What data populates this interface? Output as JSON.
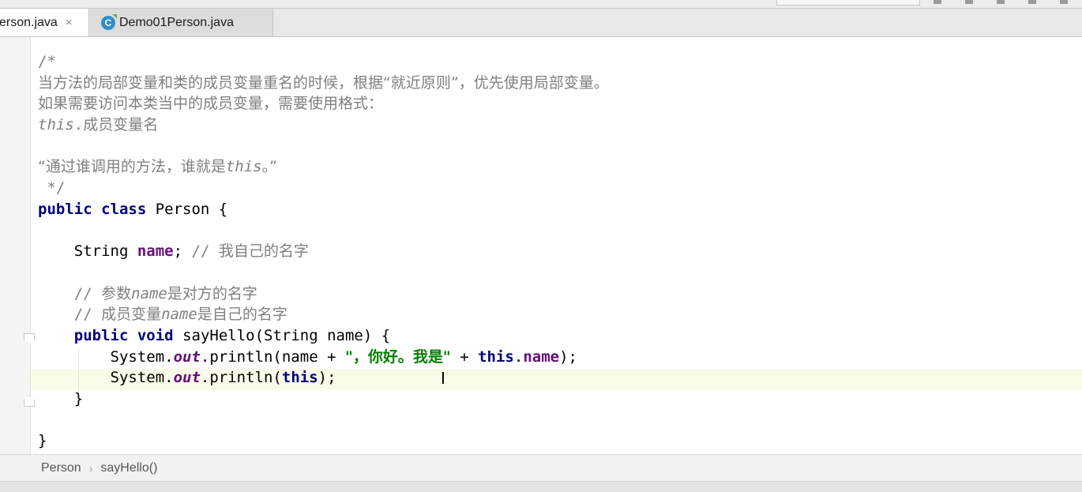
{
  "tabs": [
    {
      "label": "erson.java",
      "close": "×",
      "active": true
    },
    {
      "label": "Demo01Person.java",
      "close": "×",
      "active": false,
      "icon": "class-icon",
      "icon_letter": "C"
    }
  ],
  "code_lines": [
    [
      {
        "t": "/*",
        "c": "cm"
      }
    ],
    [
      {
        "t": "当方法的局部变量和类的成员变量重名的时候，根据“就近原则”，优先使用局部变量。",
        "c": "cm cjk"
      }
    ],
    [
      {
        "t": "如果需要访问本类当中的成员变量，需要使用格式：",
        "c": "cm cjk"
      }
    ],
    [
      {
        "t": "this",
        "c": "cmt"
      },
      {
        "t": ".",
        "c": "cm"
      },
      {
        "t": "成员变量名",
        "c": "cm cjk"
      }
    ],
    [],
    [
      {
        "t": "“通过谁调用的方法，谁就是",
        "c": "cm cjk"
      },
      {
        "t": "this",
        "c": "cmt"
      },
      {
        "t": "。”",
        "c": "cm cjk"
      }
    ],
    [
      {
        "t": " */",
        "c": "cm"
      }
    ],
    [
      {
        "t": "public",
        "c": "kw"
      },
      {
        "t": " "
      },
      {
        "t": "class",
        "c": "kw"
      },
      {
        "t": " Person {"
      }
    ],
    [],
    [
      {
        "t": "    String "
      },
      {
        "t": "name",
        "c": "fld"
      },
      {
        "t": "; "
      },
      {
        "t": "// ",
        "c": "cm"
      },
      {
        "t": "我自己的名字",
        "c": "cm cjk"
      }
    ],
    [],
    [
      {
        "t": "    // ",
        "c": "cm"
      },
      {
        "t": "参数",
        "c": "cm cjk"
      },
      {
        "t": "name",
        "c": "cmt"
      },
      {
        "t": "是对方的名字",
        "c": "cm cjk"
      }
    ],
    [
      {
        "t": "    // ",
        "c": "cm"
      },
      {
        "t": "成员变量",
        "c": "cm cjk"
      },
      {
        "t": "name",
        "c": "cmt"
      },
      {
        "t": "是自己的名字",
        "c": "cm cjk"
      }
    ],
    [
      {
        "t": "    "
      },
      {
        "t": "public",
        "c": "kw"
      },
      {
        "t": " "
      },
      {
        "t": "void",
        "c": "kw"
      },
      {
        "t": " sayHello(String name) {"
      }
    ],
    [
      {
        "t": "        System."
      },
      {
        "t": "out",
        "c": "static"
      },
      {
        "t": ".println(name + "
      },
      {
        "t": "\"，你好。我是\"",
        "c": "str cjk"
      },
      {
        "t": " + "
      },
      {
        "t": "this",
        "c": "kw"
      },
      {
        "t": "."
      },
      {
        "t": "name",
        "c": "fld"
      },
      {
        "t": ");"
      }
    ],
    [
      {
        "t": "        System."
      },
      {
        "t": "out",
        "c": "static"
      },
      {
        "t": ".println("
      },
      {
        "t": "this",
        "c": "kw"
      },
      {
        "t": ");"
      }
    ],
    [
      {
        "t": "    }"
      }
    ],
    [],
    [
      {
        "t": "}"
      }
    ]
  ],
  "breadcrumb": {
    "class": "Person",
    "separator": "›",
    "method": "sayHello()"
  },
  "cursor_glyph": "I"
}
